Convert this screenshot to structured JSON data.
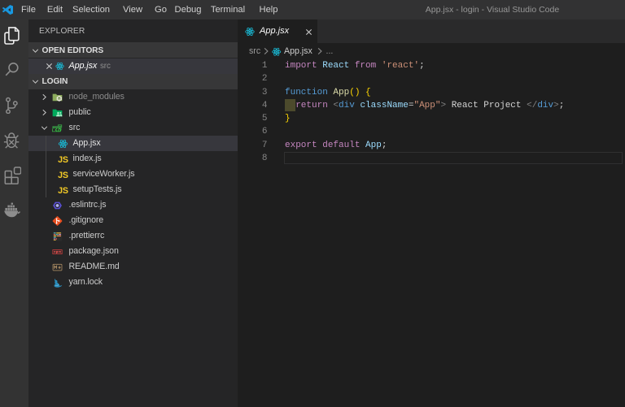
{
  "window": {
    "title": "App.jsx - login - Visual Studio Code"
  },
  "menu": {
    "items": [
      "File",
      "Edit",
      "Selection",
      "View",
      "Go",
      "Debug",
      "Terminal",
      "Help"
    ]
  },
  "activity_bar": {
    "items": [
      {
        "name": "explorer",
        "icon": "files-icon",
        "active": true
      },
      {
        "name": "search",
        "icon": "search-icon",
        "active": false
      },
      {
        "name": "source-control",
        "icon": "source-control-icon",
        "active": false
      },
      {
        "name": "debug",
        "icon": "debug-icon",
        "active": false
      },
      {
        "name": "extensions",
        "icon": "extensions-icon",
        "active": false
      },
      {
        "name": "docker",
        "icon": "docker-icon",
        "active": false
      }
    ]
  },
  "sidebar": {
    "title": "EXPLORER",
    "open_editors_header": "OPEN EDITORS",
    "open_editors": [
      {
        "label": "App.jsx",
        "detail": "src",
        "icon": "react-icon",
        "preview": true
      }
    ],
    "project_header": "LOGIN",
    "tree": [
      {
        "label": "node_modules",
        "icon": "folder-npm-icon",
        "depth": 0,
        "twistie": "right",
        "dim": true
      },
      {
        "label": "public",
        "icon": "folder-public-icon",
        "depth": 0,
        "twistie": "right",
        "dim": false
      },
      {
        "label": "src",
        "icon": "folder-src-open-icon",
        "depth": 0,
        "twistie": "down",
        "dim": false
      },
      {
        "label": "App.jsx",
        "icon": "react-icon",
        "depth": 1,
        "twistie": "none",
        "dim": false,
        "selected": true
      },
      {
        "label": "index.js",
        "icon": "js-icon",
        "depth": 1,
        "twistie": "none",
        "dim": false
      },
      {
        "label": "serviceWorker.js",
        "icon": "js-icon",
        "depth": 1,
        "twistie": "none",
        "dim": false
      },
      {
        "label": "setupTests.js",
        "icon": "js-icon",
        "depth": 1,
        "twistie": "none",
        "dim": false
      },
      {
        "label": ".eslintrc.js",
        "icon": "eslint-icon",
        "depth": 0,
        "twistie": "none",
        "dim": false
      },
      {
        "label": ".gitignore",
        "icon": "git-icon",
        "depth": 0,
        "twistie": "none",
        "dim": false
      },
      {
        "label": ".prettierrc",
        "icon": "prettier-icon",
        "depth": 0,
        "twistie": "none",
        "dim": false
      },
      {
        "label": "package.json",
        "icon": "npm-icon",
        "depth": 0,
        "twistie": "none",
        "dim": false
      },
      {
        "label": "README.md",
        "icon": "readme-icon",
        "depth": 0,
        "twistie": "none",
        "dim": false
      },
      {
        "label": "yarn.lock",
        "icon": "yarn-icon",
        "depth": 0,
        "twistie": "none",
        "dim": false
      }
    ]
  },
  "editor": {
    "tab": {
      "label": "App.jsx",
      "icon": "react-icon",
      "active": true,
      "preview": true
    },
    "breadcrumbs": {
      "folder": "src",
      "file": "App.jsx",
      "symbol": "...",
      "file_icon": "react-icon"
    },
    "code": {
      "language": "javascriptreact",
      "lines": [
        {
          "num": "1",
          "tokens": [
            [
              "import ",
              "kw"
            ],
            [
              "React ",
              "var"
            ],
            [
              "from ",
              "kw"
            ],
            [
              "'react'",
              "str"
            ],
            [
              ";",
              "pun"
            ]
          ]
        },
        {
          "num": "2",
          "tokens": []
        },
        {
          "num": "3",
          "tokens": [
            [
              "function ",
              "type"
            ],
            [
              "App",
              "fn"
            ],
            [
              "() {",
              "br"
            ]
          ]
        },
        {
          "num": "4",
          "tokens": [
            [
              "  ",
              ""
            ],
            [
              "return ",
              "kw"
            ],
            [
              "<",
              "tagp"
            ],
            [
              "div ",
              "type"
            ],
            [
              "className",
              "var"
            ],
            [
              "=",
              "pun"
            ],
            [
              "\"App\"",
              "str"
            ],
            [
              ">",
              "tagp"
            ],
            [
              " React Project ",
              "pun"
            ],
            [
              "</",
              "tagp"
            ],
            [
              "div",
              "type"
            ],
            [
              ">",
              "tagp"
            ],
            [
              ";",
              "pun"
            ]
          ]
        },
        {
          "num": "5",
          "tokens": [
            [
              "}",
              "br"
            ]
          ]
        },
        {
          "num": "6",
          "tokens": []
        },
        {
          "num": "7",
          "tokens": [
            [
              "export ",
              "kw"
            ],
            [
              "default ",
              "kw"
            ],
            [
              "App",
              "var"
            ],
            [
              ";",
              "pun"
            ]
          ]
        },
        {
          "num": "8",
          "tokens": []
        }
      ]
    }
  },
  "colors": {
    "titlebar": "#323233",
    "activitybar": "#333333",
    "sidebar": "#252526",
    "section_header": "#373738",
    "selection_row": "#37373D",
    "editor_bg": "#1e1e1e",
    "tabstrip": "#252526",
    "accent_blue_logo": "#1898e0",
    "react_cyan": "#19b9d4",
    "cursor_block": "#4c4a2c"
  }
}
